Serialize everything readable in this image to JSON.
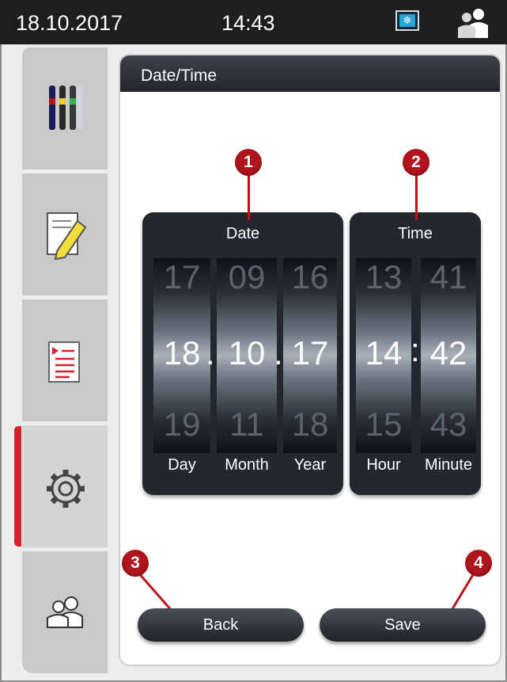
{
  "statusbar": {
    "date": "18.10.2017",
    "time": "14:43",
    "screen_icon": "snowflake-screen-icon",
    "user_icon": "user-group-icon"
  },
  "sidebar": {
    "items": [
      {
        "icon": "reagent-vials-icon"
      },
      {
        "icon": "notepad-pencil-icon"
      },
      {
        "icon": "report-list-icon"
      },
      {
        "icon": "gear-icon",
        "active": true
      },
      {
        "icon": "users-icon"
      }
    ]
  },
  "panel": {
    "title": "Date/Time"
  },
  "date_picker": {
    "title": "Date",
    "separator": ".",
    "columns": [
      {
        "prev": "17",
        "current": "18",
        "next": "19",
        "label": "Day"
      },
      {
        "prev": "09",
        "current": "10",
        "next": "11",
        "label": "Month"
      },
      {
        "prev": "16",
        "current": "17",
        "next": "18",
        "label": "Year"
      }
    ]
  },
  "time_picker": {
    "title": "Time",
    "separator": ":",
    "columns": [
      {
        "prev": "13",
        "current": "14",
        "next": "15",
        "label": "Hour"
      },
      {
        "prev": "41",
        "current": "42",
        "next": "43",
        "label": "Minute"
      }
    ]
  },
  "buttons": {
    "back": "Back",
    "save": "Save"
  },
  "callouts": [
    "1",
    "2",
    "3",
    "4"
  ],
  "colors": {
    "accent_red": "#d3202a",
    "callout_red": "#b0141d",
    "dark": "#23282e"
  }
}
